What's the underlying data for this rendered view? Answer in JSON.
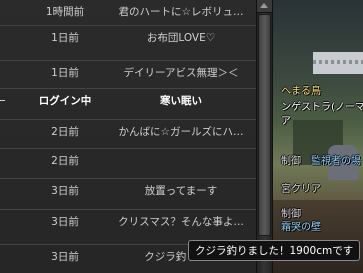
{
  "friends": [
    {
      "status": "1時間前",
      "comment": "君のハートに☆レボリュ…"
    },
    {
      "status": "1日前",
      "comment": "お布団LOVE♡"
    },
    {
      "status": "1日前",
      "comment": "デイリーアビス無理＞＜"
    },
    {
      "status": "ログイン中",
      "comment": "寒い眠い"
    },
    {
      "status": "2日前",
      "comment": "かんばに☆ガールズにハ…"
    },
    {
      "status": "2日前",
      "comment": ""
    },
    {
      "status": "3日前",
      "comment": "放置ってまーす"
    },
    {
      "status": "3日前",
      "comment": "クリスマス？そんな事よ…"
    },
    {
      "status": "3日前",
      "comment": "クジラ釣りまし"
    }
  ],
  "tooltip": "クジラ釣りました！1900cmです",
  "world": {
    "name": "へまる鳥",
    "job": "ンゲストラ(ノーマ",
    "line3": "ア",
    "title1": "制御",
    "title2": "監視者の場",
    "title3": "宮クリア",
    "title4": "制御",
    "title5": "霜哭の壁",
    "colors": {
      "name": "#ffe27a",
      "job": "#ffffff",
      "title": "#8fd0ff"
    }
  },
  "colors": {
    "panel": "#262626",
    "divider": "#444444",
    "text": "#cfcfcf"
  }
}
